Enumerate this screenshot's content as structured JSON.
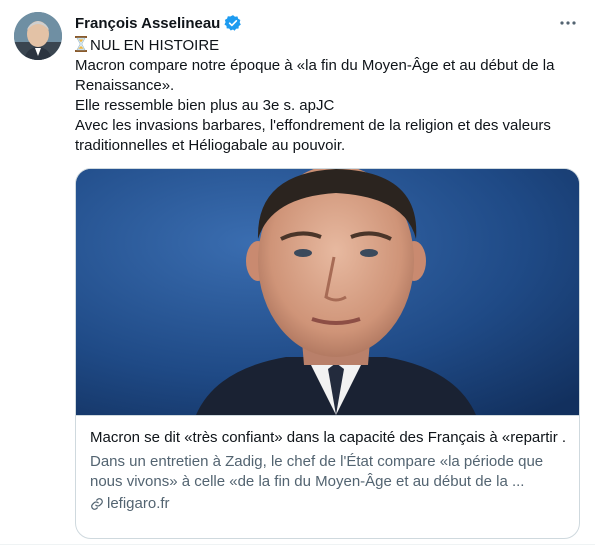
{
  "tweet": {
    "author": {
      "name": "François Asselineau",
      "verified": true
    },
    "lines": [
      "NUL EN HISTOIRE",
      "Macron compare notre époque à «la fin du Moyen-Âge et au début de la",
      "Renaissance».",
      "Elle ressemble bien plus au 3e s. apJC",
      "Avec les invasions barbares, l'effondrement de la religion et des valeurs",
      "traditionnelles et Héliogabale au pouvoir."
    ],
    "first_line_icon": "hourglass-icon"
  },
  "card": {
    "title": "Macron se dit «très confiant» dans la capacité des Français à «repartir ...",
    "description_lines": [
      "Dans un entretien à Zadig, le chef de l'État compare «la période que",
      "nous vivons» à celle «de la fin du Moyen-Âge et au début de la ..."
    ],
    "domain": "lefigaro.fr",
    "domain_icon": "link-icon"
  },
  "colors": {
    "text": "#0f1419",
    "secondary_text": "#536471",
    "verified_blue": "#1d9bf0",
    "border": "#cfd9de"
  }
}
